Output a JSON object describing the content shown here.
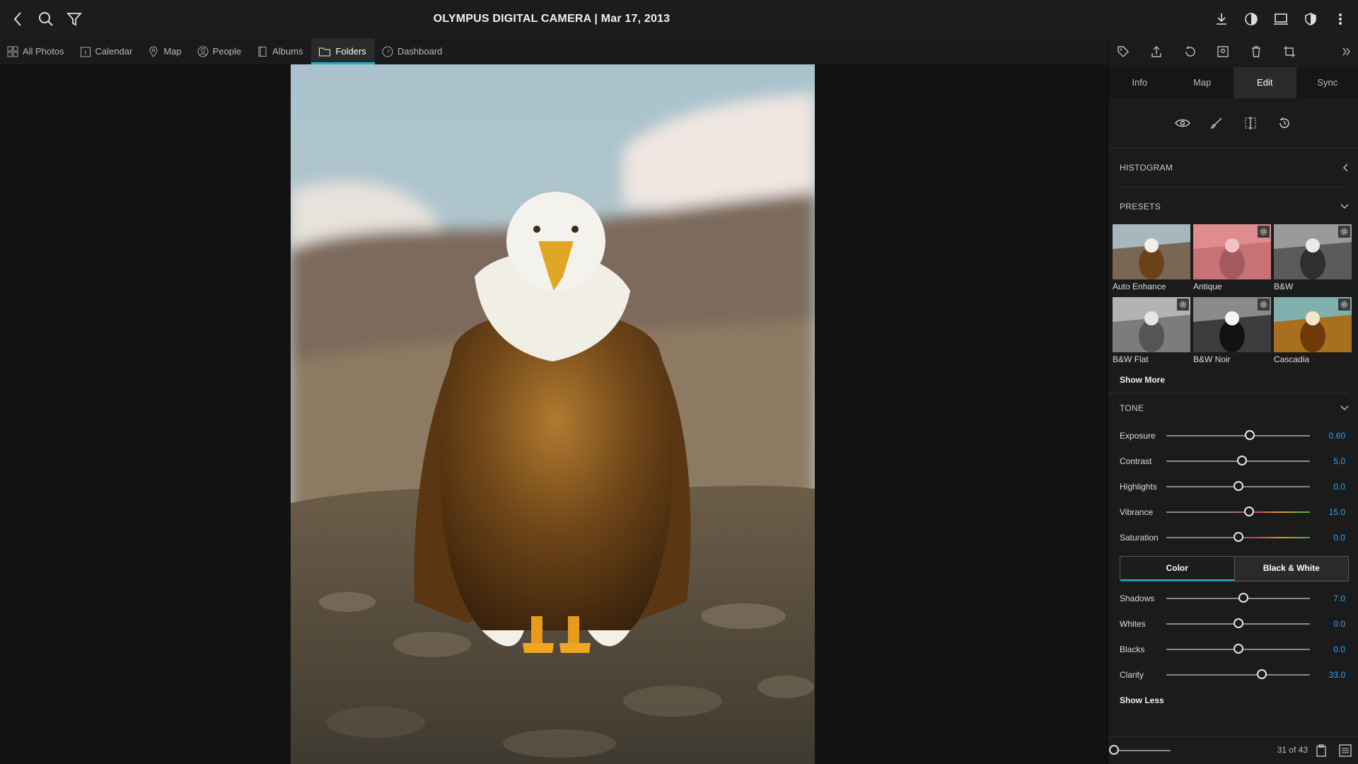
{
  "window": {
    "title": "OLYMPUS DIGITAL CAMERA | Mar 17, 2013"
  },
  "nav": {
    "items": [
      {
        "label": "All Photos",
        "icon": "grid-icon"
      },
      {
        "label": "Calendar",
        "icon": "calendar-icon"
      },
      {
        "label": "Map",
        "icon": "map-pin-icon"
      },
      {
        "label": "People",
        "icon": "person-icon"
      },
      {
        "label": "Albums",
        "icon": "album-icon"
      },
      {
        "label": "Folders",
        "icon": "folder-icon"
      },
      {
        "label": "Dashboard",
        "icon": "dashboard-icon"
      }
    ],
    "active": "Folders"
  },
  "panel_tabs": [
    "Info",
    "Map",
    "Edit",
    "Sync"
  ],
  "active_tab": "Edit",
  "histogram": {
    "title": "HISTOGRAM"
  },
  "presets": {
    "title": "PRESETS",
    "items": [
      "Auto Enhance",
      "Antique",
      "B&W",
      "B&W Flat",
      "B&W Noir",
      "Cascadia"
    ],
    "show_more": "Show More"
  },
  "tone": {
    "title": "TONE",
    "sliders_top": [
      {
        "label": "Exposure",
        "value": "0.60",
        "position": 0.58
      },
      {
        "label": "Contrast",
        "value": "5.0",
        "position": 0.525
      },
      {
        "label": "Highlights",
        "value": "0.0",
        "position": 0.5
      },
      {
        "label": "Vibrance",
        "value": "15.0",
        "position": 0.575
      },
      {
        "label": "Saturation",
        "value": "0.0",
        "position": 0.5
      }
    ],
    "mode": {
      "color": "Color",
      "bw": "Black & White",
      "selected": "Color"
    },
    "sliders_bottom": [
      {
        "label": "Shadows",
        "value": "7.0",
        "position": 0.535
      },
      {
        "label": "Whites",
        "value": "0.0",
        "position": 0.5
      },
      {
        "label": "Blacks",
        "value": "0.0",
        "position": 0.5
      },
      {
        "label": "Clarity",
        "value": "33.0",
        "position": 0.665
      }
    ],
    "show_less": "Show Less"
  },
  "footer": {
    "counter": "31 of 43",
    "zoom": 0
  },
  "colors": {
    "accent": "#18b2c8",
    "value": "#2aa3ff"
  }
}
